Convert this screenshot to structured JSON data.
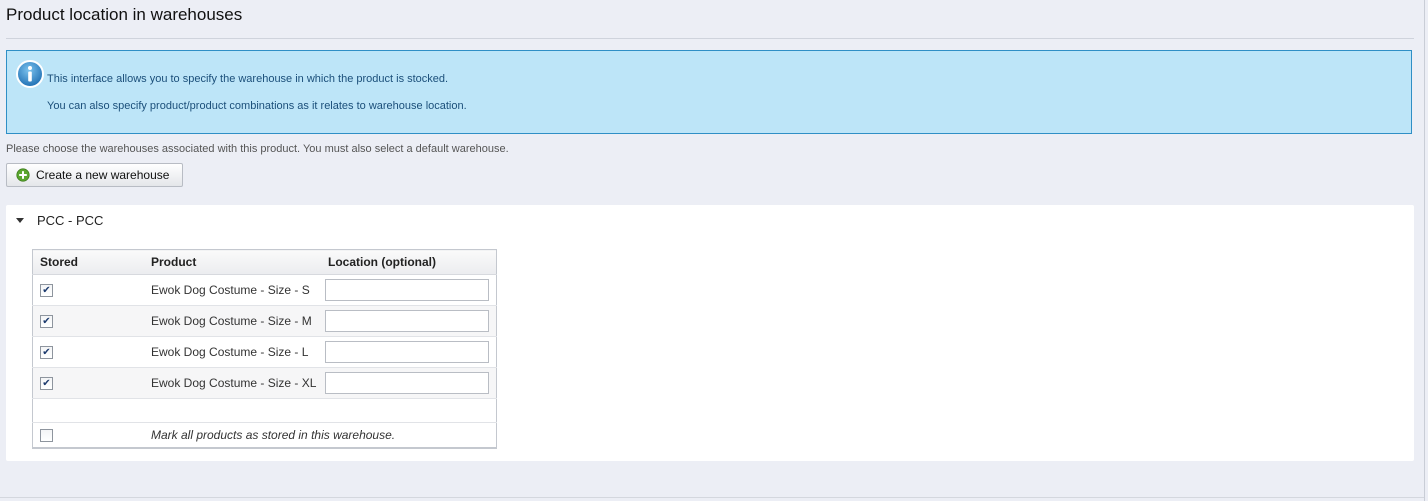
{
  "page": {
    "title": "Product location in warehouses"
  },
  "info": {
    "line1": "This interface allows you to specify the warehouse in which the product is stocked.",
    "line2": "You can also specify product/product combinations as it relates to warehouse location."
  },
  "instructions": {
    "text": "Please choose the warehouses associated with this product. You must also select a default warehouse."
  },
  "toolbar": {
    "create_label": "Create a new warehouse"
  },
  "warehouse": {
    "title": "PCC - PCC",
    "columns": {
      "stored": "Stored",
      "product": "Product",
      "location": "Location (optional)"
    },
    "rows": [
      {
        "product": "Ewok Dog Costume - Size - S",
        "stored": true,
        "location": ""
      },
      {
        "product": "Ewok Dog Costume - Size - M",
        "stored": true,
        "location": ""
      },
      {
        "product": "Ewok Dog Costume - Size - L",
        "stored": true,
        "location": ""
      },
      {
        "product": "Ewok Dog Costume - Size - XL",
        "stored": true,
        "location": ""
      }
    ],
    "mark_all": {
      "label": "Mark all products as stored in this warehouse.",
      "checked": false
    }
  },
  "icons": {
    "info": "info-icon",
    "create": "plus-circle-icon",
    "toggle": "caret-down-icon"
  },
  "colors": {
    "info_background": "#bde5f8",
    "info_border": "#2f8fc6",
    "info_text": "#1b4f7a",
    "plus_icon": "#5aa62e"
  }
}
